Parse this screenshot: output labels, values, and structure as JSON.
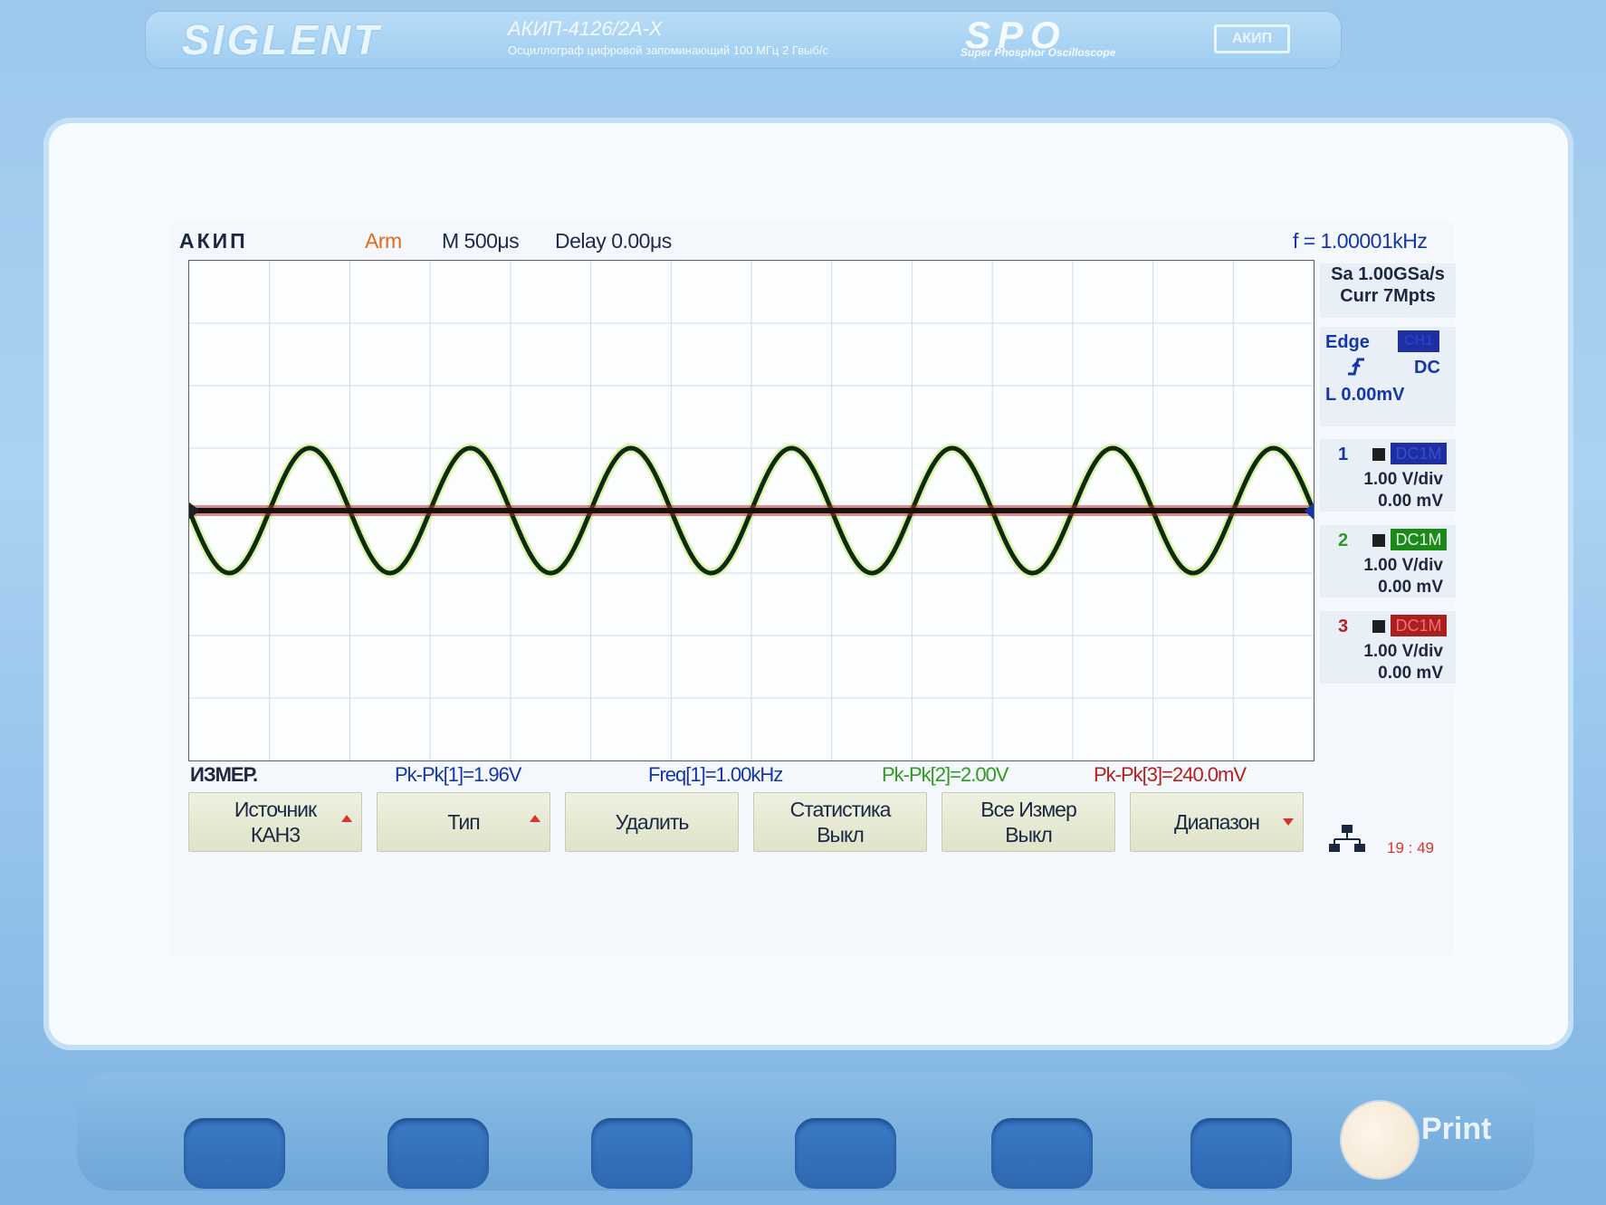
{
  "instrument": {
    "brand": "SIGLENT",
    "model": "АКИП-4126/2А-Х",
    "description": "Осциллограф цифровой запоминающий  100 МГц  2 Гвыб/с",
    "spo_logo": "SPO",
    "spo_subtitle": "Super Phosphor Oscilloscope",
    "badge": "АКИП"
  },
  "status_bar": {
    "brand_label": "АКИП",
    "acquisition_state": "Arm",
    "timebase": "M 500μs",
    "delay": "Delay 0.00μs",
    "frequency": "f = 1.00001kHz"
  },
  "acquisition": {
    "sample_rate": "Sa 1.00GSa/s",
    "memory_depth": "Curr 7Mpts"
  },
  "trigger": {
    "type": "Edge",
    "source": "CH1",
    "coupling": "DC",
    "level": "L  0.00mV",
    "slope_icon": "rising-edge-icon"
  },
  "channels": [
    {
      "number": "1",
      "coupling": "DC1M",
      "scale": "1.00 V/div",
      "offset": "0.00 mV",
      "color": "#1536a8"
    },
    {
      "number": "2",
      "coupling": "DC1M",
      "scale": "1.00 V/div",
      "offset": "0.00 mV",
      "color": "#2e9a1f"
    },
    {
      "number": "3",
      "coupling": "DC1M",
      "scale": "1.00 V/div",
      "offset": "0.00 mV",
      "color": "#b41f1f"
    }
  ],
  "measurements": {
    "title": "ИЗМЕР.",
    "items": [
      "Pk-Pk[1]=1.96V",
      "Freq[1]=1.00kHz",
      "Pk-Pk[2]=2.00V",
      "Pk-Pk[3]=240.0mV"
    ]
  },
  "softkeys": [
    {
      "line1": "Источник",
      "line2": "КАН3",
      "arrow": "up"
    },
    {
      "line1": "Тип",
      "line2": "",
      "arrow": "up"
    },
    {
      "line1": "Удалить",
      "line2": "",
      "arrow": ""
    },
    {
      "line1": "Статистика",
      "line2": "Выкл",
      "arrow": ""
    },
    {
      "line1": "Все Измер",
      "line2": "Выкл",
      "arrow": ""
    },
    {
      "line1": "Диапазон",
      "line2": "",
      "arrow": "down"
    }
  ],
  "clock": "19 : 49",
  "print_label": "Print",
  "chart_data": {
    "type": "line",
    "title": "",
    "xlabel": "",
    "ylabel": "",
    "x_divisions": 14,
    "y_divisions": 8,
    "series": [
      {
        "name": "2",
        "shape": "sine",
        "cycles_on_screen": 7,
        "amplitude_div": 1.0,
        "start_phase": "falling from center",
        "color": "#2e9a1f"
      },
      {
        "name": "3",
        "shape": "flat",
        "amplitude_div": 0.0,
        "color": "#b41f1f"
      }
    ]
  }
}
